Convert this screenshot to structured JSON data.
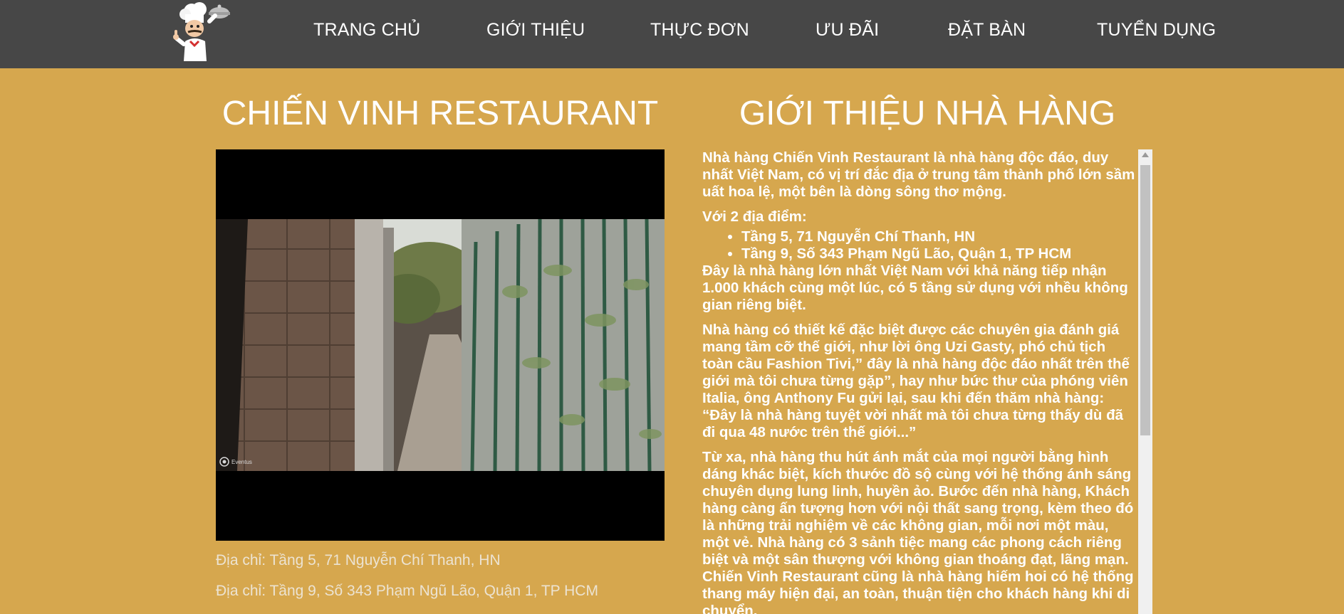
{
  "nav": {
    "logo_icon": "chef-logo-icon",
    "items": [
      {
        "label": "TRANG CHỦ"
      },
      {
        "label": "GIỚI THIỆU"
      },
      {
        "label": "THỰC ĐƠN"
      },
      {
        "label": "ƯU ĐÃI"
      },
      {
        "label": "ĐẶT BÀN"
      },
      {
        "label": "TUYỂN DỤNG"
      }
    ]
  },
  "left": {
    "title": "CHIẾN VINH RESTAURANT",
    "video": {
      "watermark": "Eventus"
    },
    "addresses": [
      "Địa chỉ: Tầng 5, 71 Nguyễn Chí Thanh, HN",
      "Địa chỉ: Tầng 9, Số 343 Phạm Ngũ Lão, Quận 1, TP HCM"
    ]
  },
  "right": {
    "title": "GIỚI THIỆU NHÀ HÀNG",
    "p1": "Nhà hàng Chiến Vinh Restaurant là nhà hàng độc đáo, duy nhất Việt Nam, có vị trí đắc địa ở trung tâm thành phố lớn sầm uất hoa lệ, một bên là dòng sông thơ mộng.",
    "p2": "Với 2 địa điểm:",
    "locations": [
      "Tầng 5, 71 Nguyễn Chí Thanh, HN",
      "Tầng 9, Số 343 Phạm Ngũ Lão, Quận 1, TP HCM"
    ],
    "p3": "Đây là nhà hàng lớn nhất Việt Nam với khả năng tiếp nhận 1.000 khách cùng một lúc, có 5 tầng sử dụng với nhều không gian riêng biệt.",
    "p4": "Nhà hàng có thiết kế đặc biệt được các chuyên gia đánh giá mang tầm cỡ thế giới, như lời ông Uzi Gasty, phó chủ tịch toàn cầu Fashion Tivi,” đây là nhà hàng độc đáo nhất trên thế giới mà tôi chưa từng gặp”, hay như bức thư của phóng viên Italia, ông Anthony Fu gửi lại, sau khi đến thăm nhà hàng: “Đây là nhà hàng tuyệt vời nhất mà tôi chưa từng thấy dù đã đi qua 48 nước trên thế giới...”",
    "p5": "Từ xa, nhà hàng thu hút ánh mắt của mọi người bằng hình dáng khác biệt, kích thước đồ sộ cùng với hệ thống ánh sáng chuyên dụng lung linh, huyền ảo. Bước đến nhà hàng, Khách hàng càng ấn tượng hơn với nội thất sang trọng, kèm theo đó là những trải nghiệm về các không gian, mỗi nơi một màu, một vẻ. Nhà hàng có 3 sảnh tiệc mang các phong cách riêng biệt và một sân thượng với không gian thoáng đạt, lãng mạn. Chiến Vinh Restaurant cũng là nhà hàng hiếm hoi có hệ thống thang máy hiện đại, an toàn, thuận tiện cho khách hàng khi di chuyển."
  },
  "colors": {
    "page_bg": "#d6a74e",
    "nav_bg": "#474747",
    "text": "#ffffff"
  }
}
